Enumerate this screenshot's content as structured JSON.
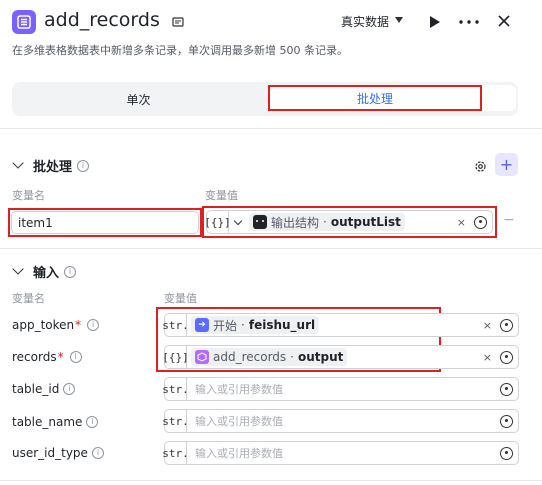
{
  "header": {
    "title": "add_records",
    "mode": "真实数据",
    "description": "在多维表格数据表中新增多条记录，单次调用最多新增 500 条记录。"
  },
  "tabs": {
    "single": "单次",
    "batch": "批处理"
  },
  "batch_section": {
    "title": "批处理",
    "col_name": "变量名",
    "col_value": "变量值",
    "row": {
      "name": "item1",
      "type": "[{}]",
      "ref_source": "输出结构",
      "ref_sep": "·",
      "ref_var": "outputList",
      "clear": "×",
      "remove": "−"
    }
  },
  "input_section": {
    "title": "输入",
    "col_name": "变量名",
    "col_value": "变量值",
    "rows": [
      {
        "label": "app_token",
        "required": "*",
        "type": "str.",
        "ref_source": "开始",
        "ref_sep": "·",
        "ref_var": "feishu_url",
        "clear": "×"
      },
      {
        "label": "records",
        "required": "*",
        "type": "[{}]",
        "ref_source": "add_records",
        "ref_sep": "·",
        "ref_var": "output",
        "clear": "×"
      },
      {
        "label": "table_id",
        "type": "str.",
        "placeholder": "输入或引用参数值"
      },
      {
        "label": "table_name",
        "type": "str.",
        "placeholder": "输入或引用参数值"
      },
      {
        "label": "user_id_type",
        "type": "str.",
        "placeholder": "输入或引用参数值"
      }
    ]
  },
  "icons": {
    "node": "table-records-icon",
    "accent": "#7b61ff",
    "link": "#3370ff",
    "highlight": "#e02020"
  }
}
